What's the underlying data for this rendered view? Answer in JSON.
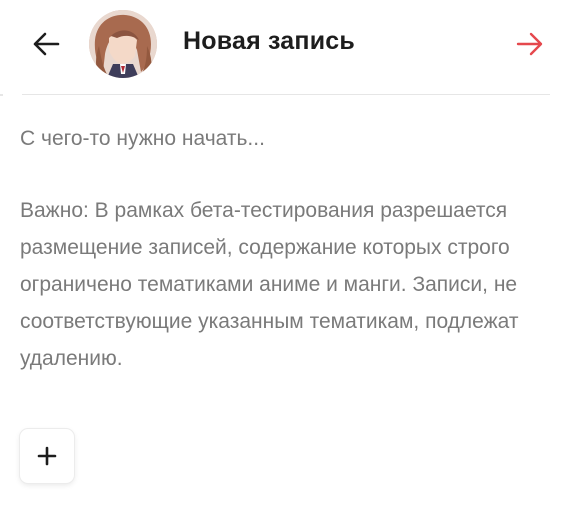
{
  "header": {
    "title": "Новая запись",
    "back_icon": "arrow-left-icon",
    "forward_icon": "arrow-right-icon",
    "forward_color": "#e5484d"
  },
  "editor": {
    "placeholder": "С чего-то нужно начать...",
    "notice": "Важно: В рамках бета-тестирования разрешается размещение записей, содержание которых строго ограничено тематиками аниме и манги. Записи, не соответствующие указанным тематикам, подлежат удалению."
  },
  "actions": {
    "add_label": "+",
    "add_icon": "plus-icon"
  }
}
